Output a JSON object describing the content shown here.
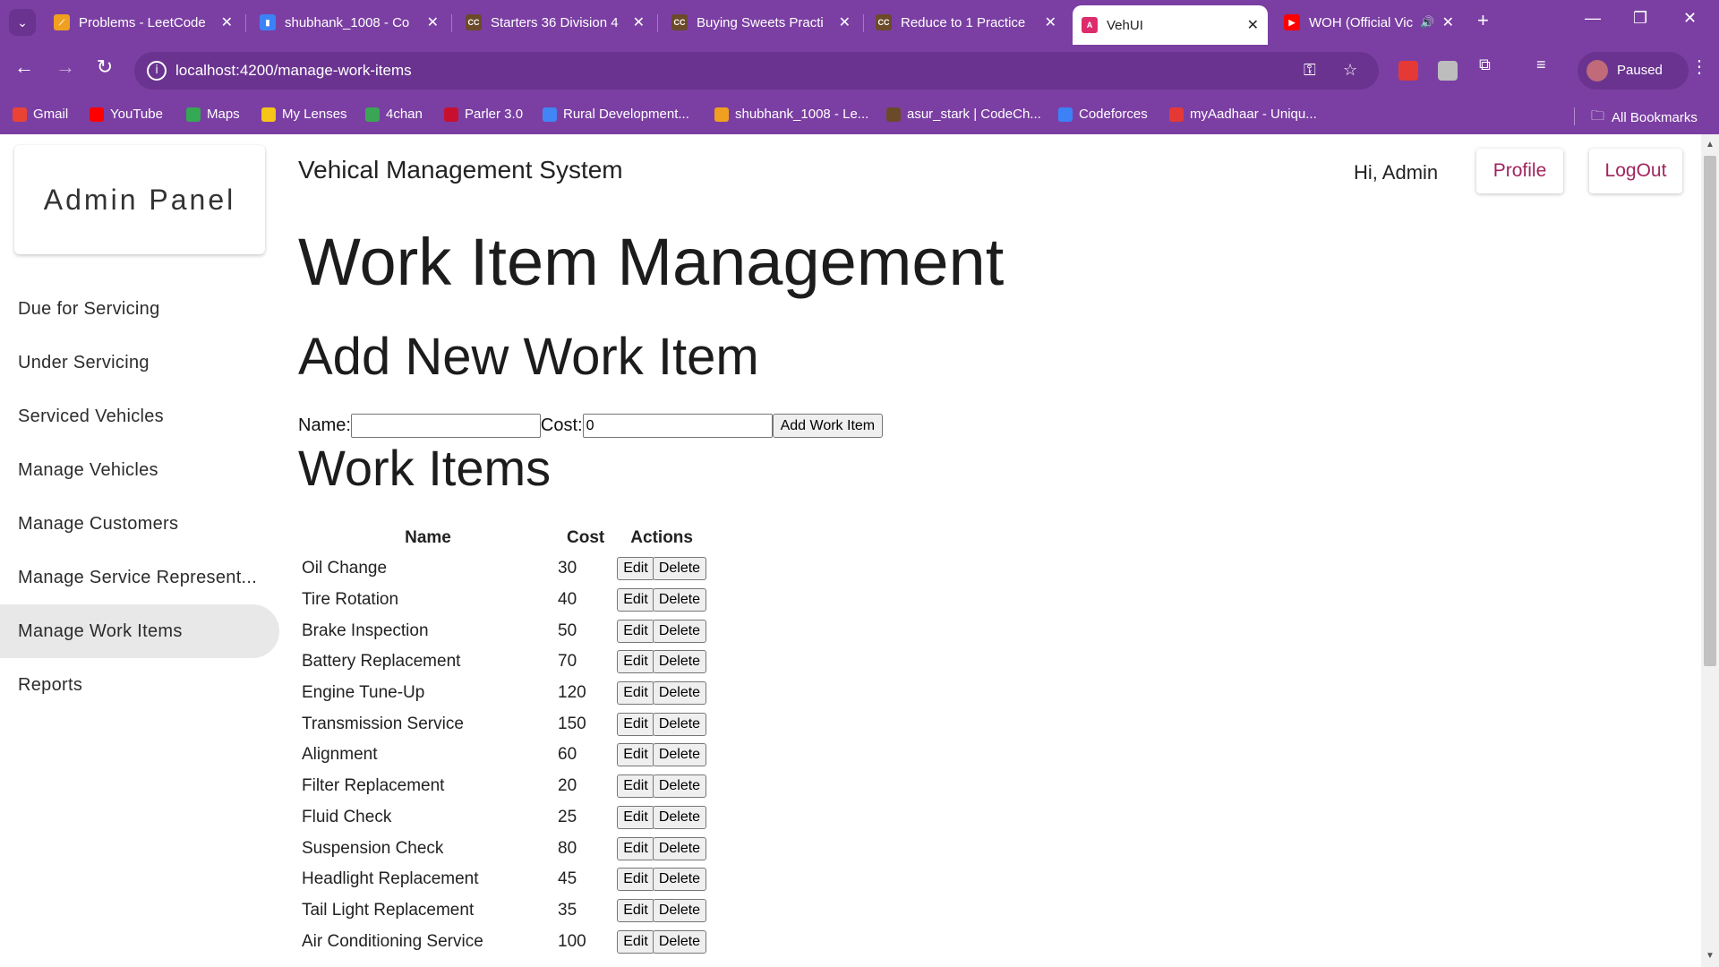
{
  "browser": {
    "tabs": [
      {
        "title": "Problems - LeetCode",
        "favicon_color": "#f0a020",
        "favicon_glyph": "⟋"
      },
      {
        "title": "shubhank_1008 - Co",
        "favicon_color": "#3b82f6",
        "favicon_glyph": "▮"
      },
      {
        "title": "Starters 36 Division 4",
        "favicon_color": "#6b4a2a",
        "favicon_glyph": "CC"
      },
      {
        "title": "Buying Sweets Practi",
        "favicon_color": "#6b4a2a",
        "favicon_glyph": "CC"
      },
      {
        "title": "Reduce to 1 Practice",
        "favicon_color": "#6b4a2a",
        "favicon_glyph": "CC"
      },
      {
        "title": "VehUI",
        "favicon_color": "#dd2c6b",
        "favicon_glyph": "A"
      },
      {
        "title": "WOH (Official Vic",
        "favicon_color": "#ff0000",
        "favicon_glyph": "▶"
      }
    ],
    "url": "localhost:4200/manage-work-items",
    "profile_status": "Paused",
    "bookmarks": [
      {
        "label": "Gmail",
        "color": "#ea4335"
      },
      {
        "label": "YouTube",
        "color": "#ff0000"
      },
      {
        "label": "Maps",
        "color": "#34a853"
      },
      {
        "label": "My Lenses",
        "color": "#f5c518"
      },
      {
        "label": "4chan",
        "color": "#3aa655"
      },
      {
        "label": "Parler 3.0",
        "color": "#c8102e"
      },
      {
        "label": "Rural Development...",
        "color": "#4285f4"
      },
      {
        "label": "shubhank_1008 - Le...",
        "color": "#f0a020"
      },
      {
        "label": "asur_stark | CodeCh...",
        "color": "#6b4a2a"
      },
      {
        "label": "Codeforces",
        "color": "#3b82f6"
      },
      {
        "label": "myAadhaar - Uniqu...",
        "color": "#e53935"
      }
    ],
    "all_bookmarks_label": "All Bookmarks",
    "chrome_color": "#7b3fa3"
  },
  "sidebar": {
    "brand": "Admin Panel",
    "items": [
      {
        "label": "Due for Servicing"
      },
      {
        "label": "Under Servicing"
      },
      {
        "label": "Serviced Vehicles"
      },
      {
        "label": "Manage Vehicles"
      },
      {
        "label": "Manage Customers"
      },
      {
        "label": "Manage Service Represent..."
      },
      {
        "label": "Manage Work Items",
        "active": true
      },
      {
        "label": "Reports"
      }
    ]
  },
  "header": {
    "app_title": "Vehical Management System",
    "greeting": "Hi, Admin",
    "profile_label": "Profile",
    "logout_label": "LogOut",
    "accent_color": "#a0245d"
  },
  "main": {
    "page_title": "Work Item Management",
    "add_heading": "Add New Work Item",
    "form": {
      "name_label": "Name:",
      "name_value": "",
      "cost_label": "Cost:",
      "cost_value": "0",
      "submit_label": "Add Work Item"
    },
    "list_heading": "Work Items",
    "table": {
      "columns": [
        "Name",
        "Cost",
        "Actions"
      ],
      "edit_label": "Edit",
      "delete_label": "Delete",
      "rows": [
        {
          "name": "Oil Change",
          "cost": "30"
        },
        {
          "name": "Tire Rotation",
          "cost": "40"
        },
        {
          "name": "Brake Inspection",
          "cost": "50"
        },
        {
          "name": "Battery Replacement",
          "cost": "70"
        },
        {
          "name": "Engine Tune-Up",
          "cost": "120"
        },
        {
          "name": "Transmission Service",
          "cost": "150"
        },
        {
          "name": "Alignment",
          "cost": "60"
        },
        {
          "name": "Filter Replacement",
          "cost": "20"
        },
        {
          "name": "Fluid Check",
          "cost": "25"
        },
        {
          "name": "Suspension Check",
          "cost": "80"
        },
        {
          "name": "Headlight Replacement",
          "cost": "45"
        },
        {
          "name": "Tail Light Replacement",
          "cost": "35"
        },
        {
          "name": "Air Conditioning Service",
          "cost": "100"
        }
      ]
    }
  }
}
